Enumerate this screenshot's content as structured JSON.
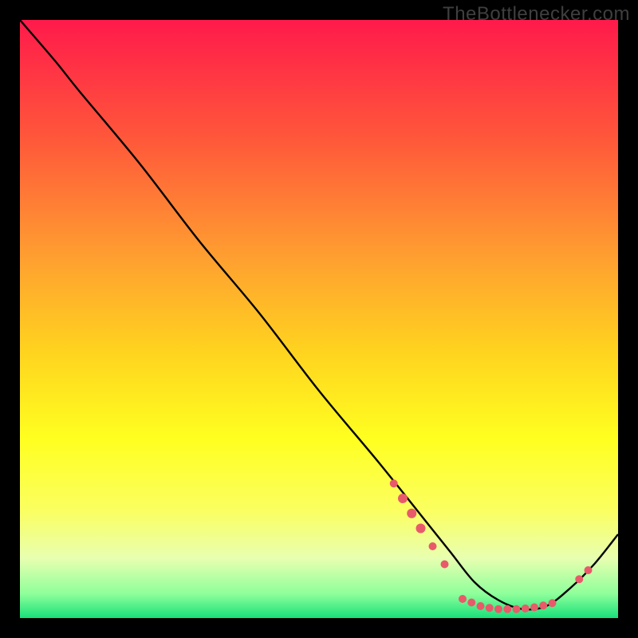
{
  "watermark": "TheBottlenecker.com",
  "chart_data": {
    "type": "line",
    "title": "",
    "xlabel": "",
    "ylabel": "",
    "xlim": [
      0,
      100
    ],
    "ylim": [
      0,
      100
    ],
    "background_gradient": {
      "stops": [
        {
          "offset": 0,
          "color": "#ff1a4b"
        },
        {
          "offset": 20,
          "color": "#ff583a"
        },
        {
          "offset": 40,
          "color": "#ffa030"
        },
        {
          "offset": 55,
          "color": "#ffd21f"
        },
        {
          "offset": 70,
          "color": "#ffff20"
        },
        {
          "offset": 82,
          "color": "#fbff60"
        },
        {
          "offset": 90,
          "color": "#e8ffb0"
        },
        {
          "offset": 96,
          "color": "#8dff9a"
        },
        {
          "offset": 100,
          "color": "#18e07a"
        }
      ]
    },
    "series": [
      {
        "name": "bottleneck-curve",
        "x": [
          0,
          6,
          10,
          20,
          30,
          40,
          50,
          60,
          68,
          72,
          76,
          80,
          84,
          88,
          92,
          96,
          100
        ],
        "y": [
          100,
          93,
          88,
          76,
          63,
          51,
          38,
          26,
          16,
          11,
          6,
          3,
          1.5,
          2,
          5,
          9,
          14
        ]
      }
    ],
    "markers": {
      "name": "highlight-points",
      "color": "#e85a6a",
      "points": [
        {
          "x": 62.5,
          "y": 22.5,
          "r": 5
        },
        {
          "x": 64.0,
          "y": 20.0,
          "r": 6
        },
        {
          "x": 65.5,
          "y": 17.5,
          "r": 6
        },
        {
          "x": 67.0,
          "y": 15.0,
          "r": 6
        },
        {
          "x": 69.0,
          "y": 12.0,
          "r": 5
        },
        {
          "x": 71.0,
          "y": 9.0,
          "r": 5
        },
        {
          "x": 74.0,
          "y": 3.2,
          "r": 5
        },
        {
          "x": 75.5,
          "y": 2.6,
          "r": 5
        },
        {
          "x": 77.0,
          "y": 2.0,
          "r": 5
        },
        {
          "x": 78.5,
          "y": 1.7,
          "r": 5
        },
        {
          "x": 80.0,
          "y": 1.5,
          "r": 5
        },
        {
          "x": 81.5,
          "y": 1.5,
          "r": 5
        },
        {
          "x": 83.0,
          "y": 1.5,
          "r": 5
        },
        {
          "x": 84.5,
          "y": 1.6,
          "r": 5
        },
        {
          "x": 86.0,
          "y": 1.8,
          "r": 5
        },
        {
          "x": 87.5,
          "y": 2.1,
          "r": 5
        },
        {
          "x": 89.0,
          "y": 2.5,
          "r": 5
        },
        {
          "x": 93.5,
          "y": 6.5,
          "r": 5
        },
        {
          "x": 95.0,
          "y": 8.0,
          "r": 5
        }
      ]
    }
  }
}
